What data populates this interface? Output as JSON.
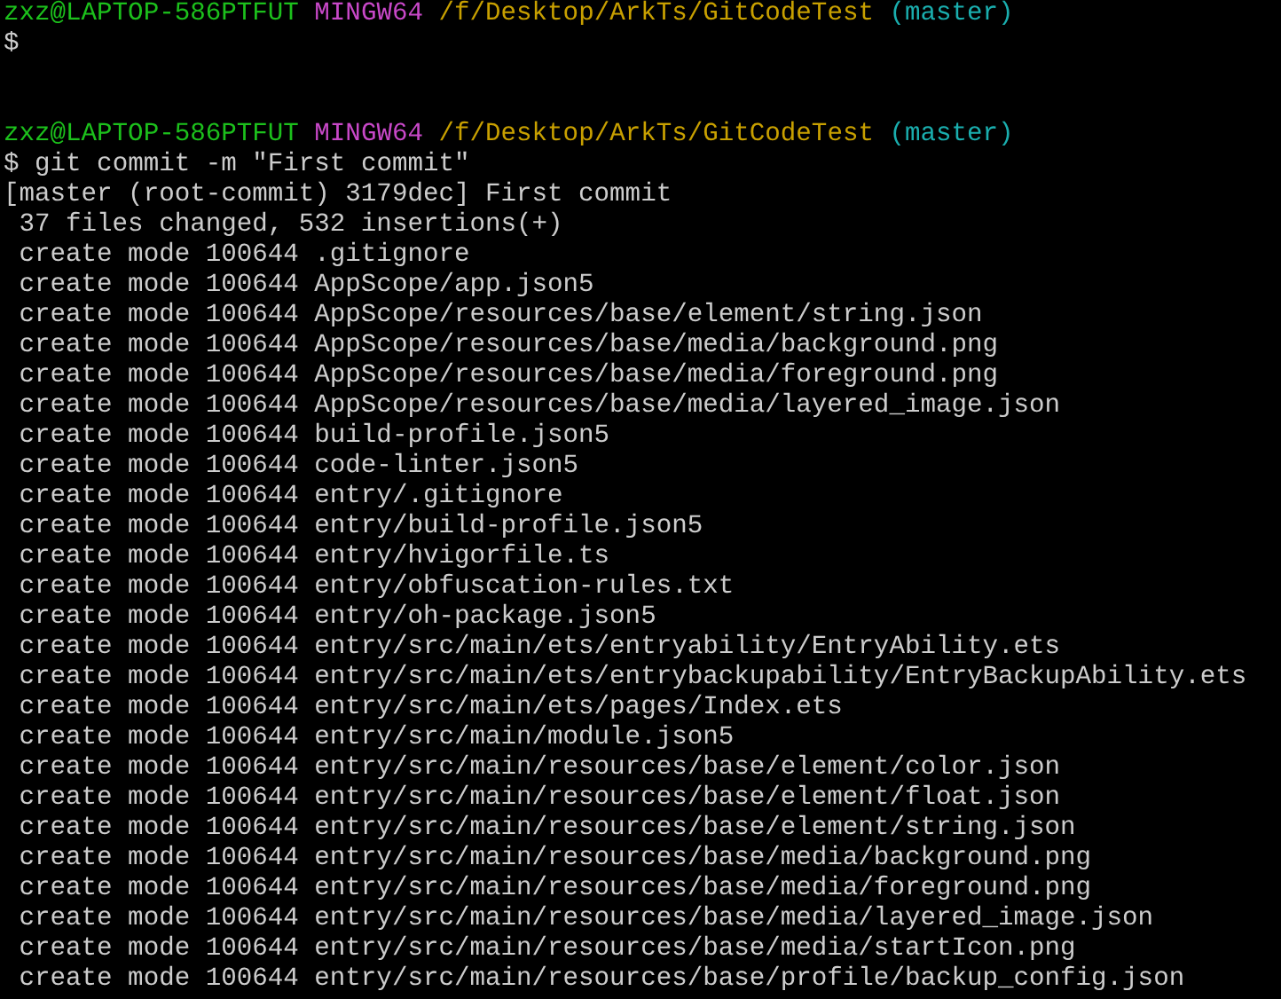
{
  "terminal": {
    "lines": [
      {
        "kind": "prompt",
        "user_host": "zxz@LAPTOP-586PTFUT",
        "shell": "MINGW64",
        "path": "/f/Desktop/ArkTs/GitCodeTest",
        "branch": "(master)"
      },
      {
        "kind": "input",
        "symbol": "$"
      },
      {
        "kind": "blank"
      },
      {
        "kind": "blank"
      },
      {
        "kind": "prompt",
        "user_host": "zxz@LAPTOP-586PTFUT",
        "shell": "MINGW64",
        "path": "/f/Desktop/ArkTs/GitCodeTest",
        "branch": "(master)"
      },
      {
        "kind": "input",
        "symbol": "$",
        "command": "git commit -m \"First commit\""
      },
      {
        "kind": "output",
        "text": "[master (root-commit) 3179dec] First commit"
      },
      {
        "kind": "output",
        "text": " 37 files changed, 532 insertions(+)"
      },
      {
        "kind": "output",
        "text": " create mode 100644 .gitignore"
      },
      {
        "kind": "output",
        "text": " create mode 100644 AppScope/app.json5"
      },
      {
        "kind": "output",
        "text": " create mode 100644 AppScope/resources/base/element/string.json"
      },
      {
        "kind": "output",
        "text": " create mode 100644 AppScope/resources/base/media/background.png"
      },
      {
        "kind": "output",
        "text": " create mode 100644 AppScope/resources/base/media/foreground.png"
      },
      {
        "kind": "output",
        "text": " create mode 100644 AppScope/resources/base/media/layered_image.json"
      },
      {
        "kind": "output",
        "text": " create mode 100644 build-profile.json5"
      },
      {
        "kind": "output",
        "text": " create mode 100644 code-linter.json5"
      },
      {
        "kind": "output",
        "text": " create mode 100644 entry/.gitignore"
      },
      {
        "kind": "output",
        "text": " create mode 100644 entry/build-profile.json5"
      },
      {
        "kind": "output",
        "text": " create mode 100644 entry/hvigorfile.ts"
      },
      {
        "kind": "output",
        "text": " create mode 100644 entry/obfuscation-rules.txt"
      },
      {
        "kind": "output",
        "text": " create mode 100644 entry/oh-package.json5"
      },
      {
        "kind": "output",
        "text": " create mode 100644 entry/src/main/ets/entryability/EntryAbility.ets"
      },
      {
        "kind": "output",
        "text": " create mode 100644 entry/src/main/ets/entrybackupability/EntryBackupAbility.ets"
      },
      {
        "kind": "output",
        "text": " create mode 100644 entry/src/main/ets/pages/Index.ets"
      },
      {
        "kind": "output",
        "text": " create mode 100644 entry/src/main/module.json5"
      },
      {
        "kind": "output",
        "text": " create mode 100644 entry/src/main/resources/base/element/color.json"
      },
      {
        "kind": "output",
        "text": " create mode 100644 entry/src/main/resources/base/element/float.json"
      },
      {
        "kind": "output",
        "text": " create mode 100644 entry/src/main/resources/base/element/string.json"
      },
      {
        "kind": "output",
        "text": " create mode 100644 entry/src/main/resources/base/media/background.png"
      },
      {
        "kind": "output",
        "text": " create mode 100644 entry/src/main/resources/base/media/foreground.png"
      },
      {
        "kind": "output",
        "text": " create mode 100644 entry/src/main/resources/base/media/layered_image.json"
      },
      {
        "kind": "output",
        "text": " create mode 100644 entry/src/main/resources/base/media/startIcon.png"
      },
      {
        "kind": "output",
        "text": " create mode 100644 entry/src/main/resources/base/profile/backup_config.json"
      }
    ]
  }
}
